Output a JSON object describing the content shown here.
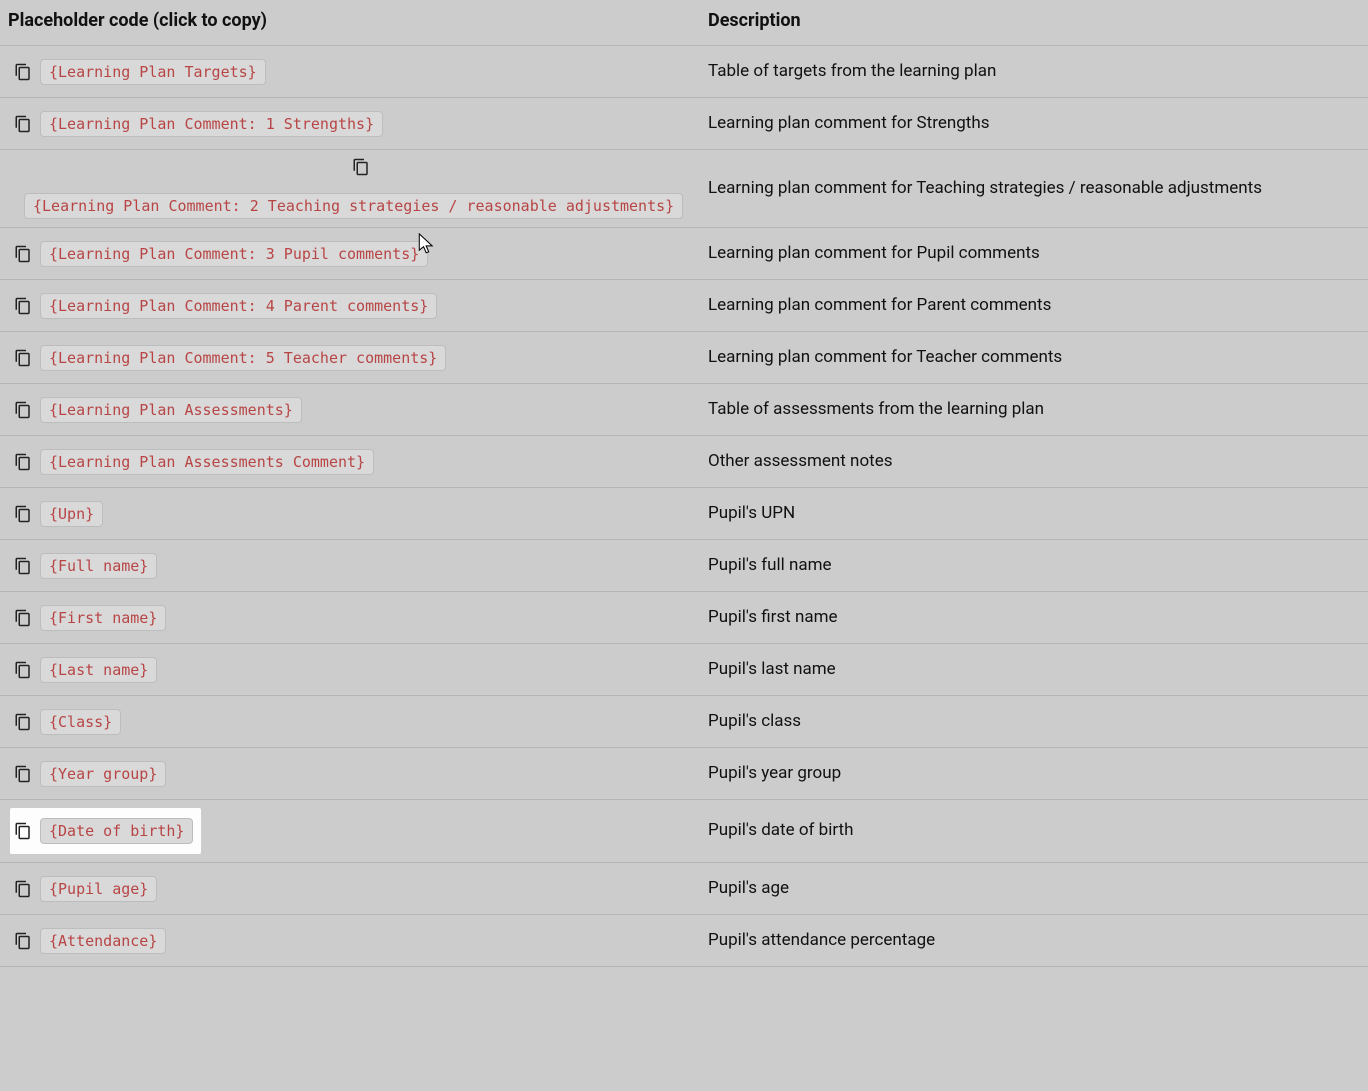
{
  "headers": {
    "code": "Placeholder code (click to copy)",
    "description": "Description"
  },
  "rows": [
    {
      "code": "{Learning Plan Targets}",
      "desc": "Table of targets from the learning plan",
      "layout": "inline"
    },
    {
      "code": "{Learning Plan Comment: 1 Strengths}",
      "desc": "Learning plan comment for Strengths",
      "layout": "inline"
    },
    {
      "code": "{Learning Plan Comment: 2 Teaching strategies / reasonable adjustments}",
      "desc": "Learning plan comment for Teaching strategies / reasonable adjustments",
      "layout": "stacked"
    },
    {
      "code": "{Learning Plan Comment: 3 Pupil comments}",
      "desc": "Learning plan comment for Pupil comments",
      "layout": "inline"
    },
    {
      "code": "{Learning Plan Comment: 4 Parent comments}",
      "desc": "Learning plan comment for Parent comments",
      "layout": "inline"
    },
    {
      "code": "{Learning Plan Comment: 5 Teacher comments}",
      "desc": "Learning plan comment for Teacher comments",
      "layout": "inline"
    },
    {
      "code": "{Learning Plan Assessments}",
      "desc": "Table of assessments from the learning plan",
      "layout": "inline"
    },
    {
      "code": "{Learning Plan Assessments Comment}",
      "desc": "Other assessment notes",
      "layout": "inline"
    },
    {
      "code": "{Upn}",
      "desc": "Pupil's UPN",
      "layout": "inline"
    },
    {
      "code": "{Full name}",
      "desc": "Pupil's full name",
      "layout": "inline"
    },
    {
      "code": "{First name}",
      "desc": "Pupil's first name",
      "layout": "inline"
    },
    {
      "code": "{Last name}",
      "desc": "Pupil's last name",
      "layout": "inline"
    },
    {
      "code": "{Class}",
      "desc": "Pupil's class",
      "layout": "inline"
    },
    {
      "code": "{Year group}",
      "desc": "Pupil's year group",
      "layout": "inline"
    },
    {
      "code": "{Date of birth}",
      "desc": "Pupil's date of birth",
      "layout": "inline",
      "highlighted": true
    },
    {
      "code": "{Pupil age}",
      "desc": "Pupil's age",
      "layout": "inline"
    },
    {
      "code": "{Attendance}",
      "desc": "Pupil's attendance percentage",
      "layout": "inline"
    }
  ]
}
